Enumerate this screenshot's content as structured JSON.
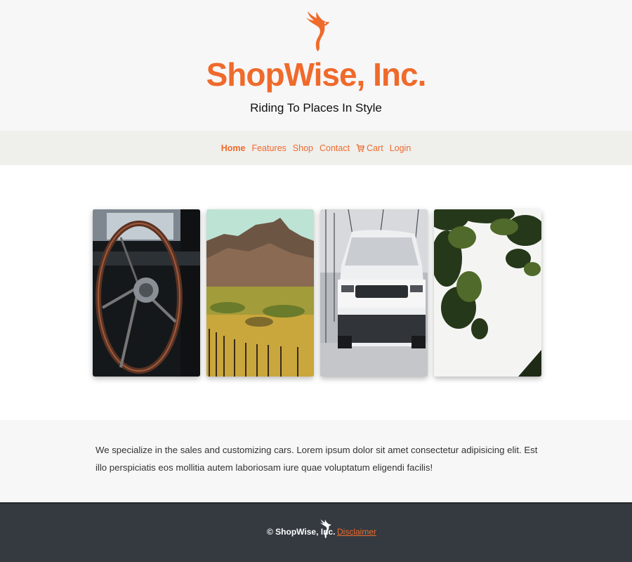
{
  "brand": {
    "name": "ShopWise, Inc.",
    "tagline": "Riding To Places In Style",
    "accent_color": "#ef6a2b",
    "logo_icon": "phoenix-bird-icon"
  },
  "nav": {
    "items": [
      {
        "label": "Home",
        "active": true
      },
      {
        "label": "Features",
        "active": false
      },
      {
        "label": "Shop",
        "active": false
      },
      {
        "label": "Contact",
        "active": false
      },
      {
        "label": "Cart",
        "active": false,
        "icon": "cart-icon"
      },
      {
        "label": "Login",
        "active": false
      }
    ]
  },
  "gallery": {
    "images": [
      {
        "subject": "vintage-steering-wheel"
      },
      {
        "subject": "mountain-landscape"
      },
      {
        "subject": "white-suv-in-snow"
      },
      {
        "subject": "tree-branches"
      }
    ]
  },
  "about": {
    "text": "We specialize in the sales and customizing cars. Lorem ipsum dolor sit amet consectetur adipisicing elit. Est illo perspiciatis eos mollitia autem laboriosam iure quae voluptatum eligendi facilis!"
  },
  "footer": {
    "copyright": "© ShopWise, Inc.",
    "disclaimer_label": "Disclaimer",
    "background": "#343a40"
  }
}
